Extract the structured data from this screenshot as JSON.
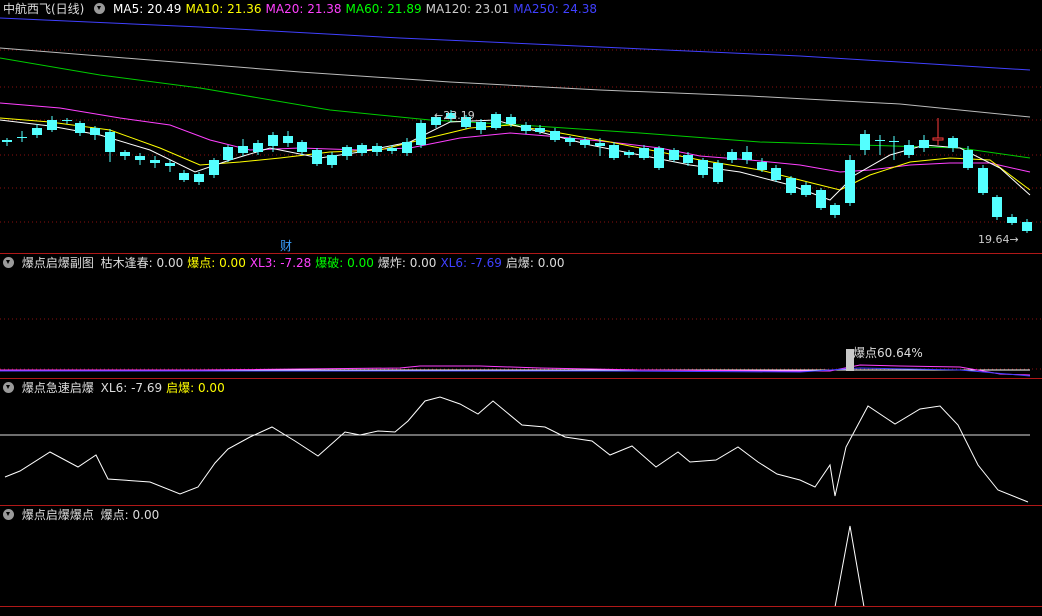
{
  "main": {
    "stock_name": "中航西飞(日线)",
    "ma": [
      {
        "label": "MA5: 20.49",
        "color": "#ffffff"
      },
      {
        "label": "MA10: 21.36",
        "color": "#ffff00"
      },
      {
        "label": "MA20: 21.38",
        "color": "#ff40ff"
      },
      {
        "label": "MA60: 21.89",
        "color": "#00ff00"
      },
      {
        "label": "MA120: 23.01",
        "color": "#cccccc"
      },
      {
        "label": "MA250: 24.38",
        "color": "#4040ff"
      }
    ],
    "high_label": "23.19",
    "low_label": "19.64",
    "event_marker": "财"
  },
  "sub1": {
    "title": "爆点启爆副图",
    "items": [
      {
        "label": "枯木逢春: 0.00",
        "color": "#dddddd"
      },
      {
        "label": "爆点: 0.00",
        "color": "#ffff00"
      },
      {
        "label": "XL3: -7.28",
        "color": "#ff40ff"
      },
      {
        "label": "爆破: 0.00",
        "color": "#00ff00"
      },
      {
        "label": "爆炸: 0.00",
        "color": "#dddddd"
      },
      {
        "label": "XL6: -7.69",
        "color": "#4040ff"
      },
      {
        "label": "启爆: 0.00",
        "color": "#dddddd"
      }
    ],
    "signal_text": "爆点60.64%"
  },
  "sub2": {
    "title": "爆点急速启爆",
    "items": [
      {
        "label": "XL6: -7.69",
        "color": "#dddddd"
      },
      {
        "label": "启爆: 0.00",
        "color": "#ffff00"
      }
    ]
  },
  "sub3": {
    "title": "爆点启爆爆点",
    "items": [
      {
        "label": "爆点: 0.00",
        "color": "#dddddd"
      }
    ]
  },
  "colors": {
    "up": "#ff3b3b",
    "down": "#54ffff",
    "separator": "#b01818"
  }
}
